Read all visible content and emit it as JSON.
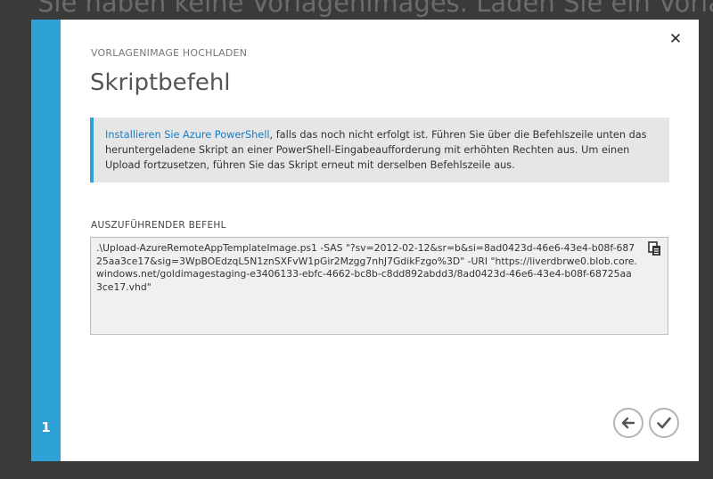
{
  "background": {
    "text": "Sie haben keine Vorlagenimages. Laden Sie ein Vorlagenim"
  },
  "dialog": {
    "subtitle": "VORLAGENIMAGE HOCHLADEN",
    "title": "Skriptbefehl",
    "step_number": "1",
    "close_icon": "close-icon"
  },
  "info": {
    "link_text": "Installieren Sie Azure PowerShell",
    "text": ", falls das noch nicht erfolgt ist. Führen Sie über die Befehlszeile unten das heruntergeladene Skript an einer PowerShell-Eingabeaufforderung mit erhöhten Rechten aus. Um einen Upload fortzusetzen, führen Sie das Skript erneut mit derselben Befehlszeile aus."
  },
  "command": {
    "label": "AUSZUFÜHRENDER BEFEHL",
    "value": ".\\Upload-AzureRemoteAppTemplateImage.ps1 -SAS \"?sv=2012-02-12&sr=b&si=8ad0423d-46e6-43e4-b08f-68725aa3ce17&sig=3WpBOEdzqL5N1znSXFvW1pGir2Mzgg7nhJ7GdikFzgo%3D\" -URI \"https://liverdbrwe0.blob.core.windows.net/goldimagestaging-e3406133-ebfc-4662-bc8b-c8dd892abdd3/8ad0423d-46e6-43e4-b08f-68725aa3ce17.vhd\""
  },
  "icons": {
    "copy": "copy-icon",
    "back": "back-arrow-icon",
    "confirm": "checkmark-icon"
  },
  "colors": {
    "accent": "#2ea2d6",
    "link": "#1a7dc4",
    "backdrop": "#3a3a3a"
  }
}
